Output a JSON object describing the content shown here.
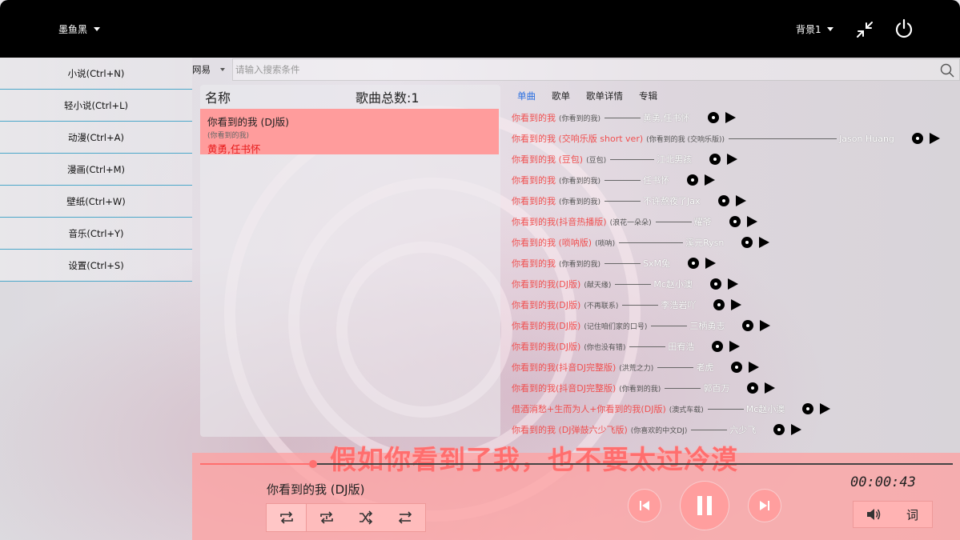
{
  "topbar": {
    "user": "墨鱼黑",
    "background_select": "背景1",
    "icons": [
      "compress-icon",
      "power-icon"
    ]
  },
  "sidebar": {
    "items": [
      {
        "label": "小说(Ctrl+N)"
      },
      {
        "label": "轻小说(Ctrl+L)"
      },
      {
        "label": "动漫(Ctrl+A)"
      },
      {
        "label": "漫画(Ctrl+M)"
      },
      {
        "label": "壁纸(Ctrl+W)"
      },
      {
        "label": "音乐(Ctrl+Y)"
      },
      {
        "label": "设置(Ctrl+S)"
      }
    ]
  },
  "search": {
    "source": "网易",
    "placeholder": "请输入搜索条件"
  },
  "playlist": {
    "col_name": "名称",
    "count": "歌曲总数:1",
    "items": [
      {
        "title": "你看到的我 (DJ版)",
        "album": "(你看到的我)",
        "artist": "黄勇,任书怀"
      }
    ]
  },
  "results": {
    "tabs": [
      {
        "label": "单曲",
        "active": true
      },
      {
        "label": "歌单",
        "active": false
      },
      {
        "label": "歌单详情",
        "active": false
      },
      {
        "label": "专辑",
        "active": false
      }
    ],
    "songs": [
      {
        "name": "你看到的我",
        "album": "(你看到的我)",
        "artist": "黄勇,任书怀"
      },
      {
        "name": "你看到的我 (交响乐版 short ver)",
        "album": "(你看到的我 (交响乐版))",
        "artist": "Jason Huang"
      },
      {
        "name": "你看到的我 (豆包)",
        "album": "(豆包)",
        "artist": "江北男孩"
      },
      {
        "name": "你看到的我",
        "album": "(你看到的我)",
        "artist": "任书怀"
      },
      {
        "name": "你看到的我",
        "album": "(你看到的我)",
        "artist": "不许熬夜了Jax"
      },
      {
        "name": "你看到的我(抖音热播版)",
        "album": "(浪花一朵朵)",
        "artist": "耀爷"
      },
      {
        "name": "你看到的我 (唢呐版)",
        "album": "(唢呐)",
        "artist": "溪元Rysn"
      },
      {
        "name": "你看到的我",
        "album": "(你看到的我)",
        "artist": "SxM兔"
      },
      {
        "name": "你看到的我(DJ版)",
        "album": "(献天缘)",
        "artist": "Mc赵小澳"
      },
      {
        "name": "你看到的我(DJ版)",
        "album": "(不再联系)",
        "artist": "李浩岩吖"
      },
      {
        "name": "你看到的我(DJ版)",
        "album": "(记住咱们家的口号)",
        "artist": "三柄勇志"
      },
      {
        "name": "你看到的我(DJ版)",
        "album": "(你也没有错)",
        "artist": "田宥浩"
      },
      {
        "name": "你看到的我(抖音DJ完整版)",
        "album": "(洪荒之力)",
        "artist": "老虎"
      },
      {
        "name": "你看到的我(抖音DJ完整版)",
        "album": "(你看到的我)",
        "artist": "郭百万"
      },
      {
        "name": "借酒消愁+生而为人+你看到的我(DJ版)",
        "album": "(澳式车载)",
        "artist": "Mc赵小澳"
      },
      {
        "name": "你看到的我 (DJ弹鼓六少飞版)",
        "album": "(你喜欢的中文DJ)",
        "artist": "六少飞"
      }
    ]
  },
  "player": {
    "lyric": "假如你看到了我，也不要太过冷漠",
    "now_playing": "你看到的我 (DJ版)",
    "time": "00:00:43",
    "progress": 0.15,
    "lyrics_button": "词",
    "mode_icons": [
      "repeat-all-icon",
      "repeat-one-icon",
      "shuffle-icon",
      "sequential-icon"
    ],
    "accent": "#ff6e6e"
  }
}
